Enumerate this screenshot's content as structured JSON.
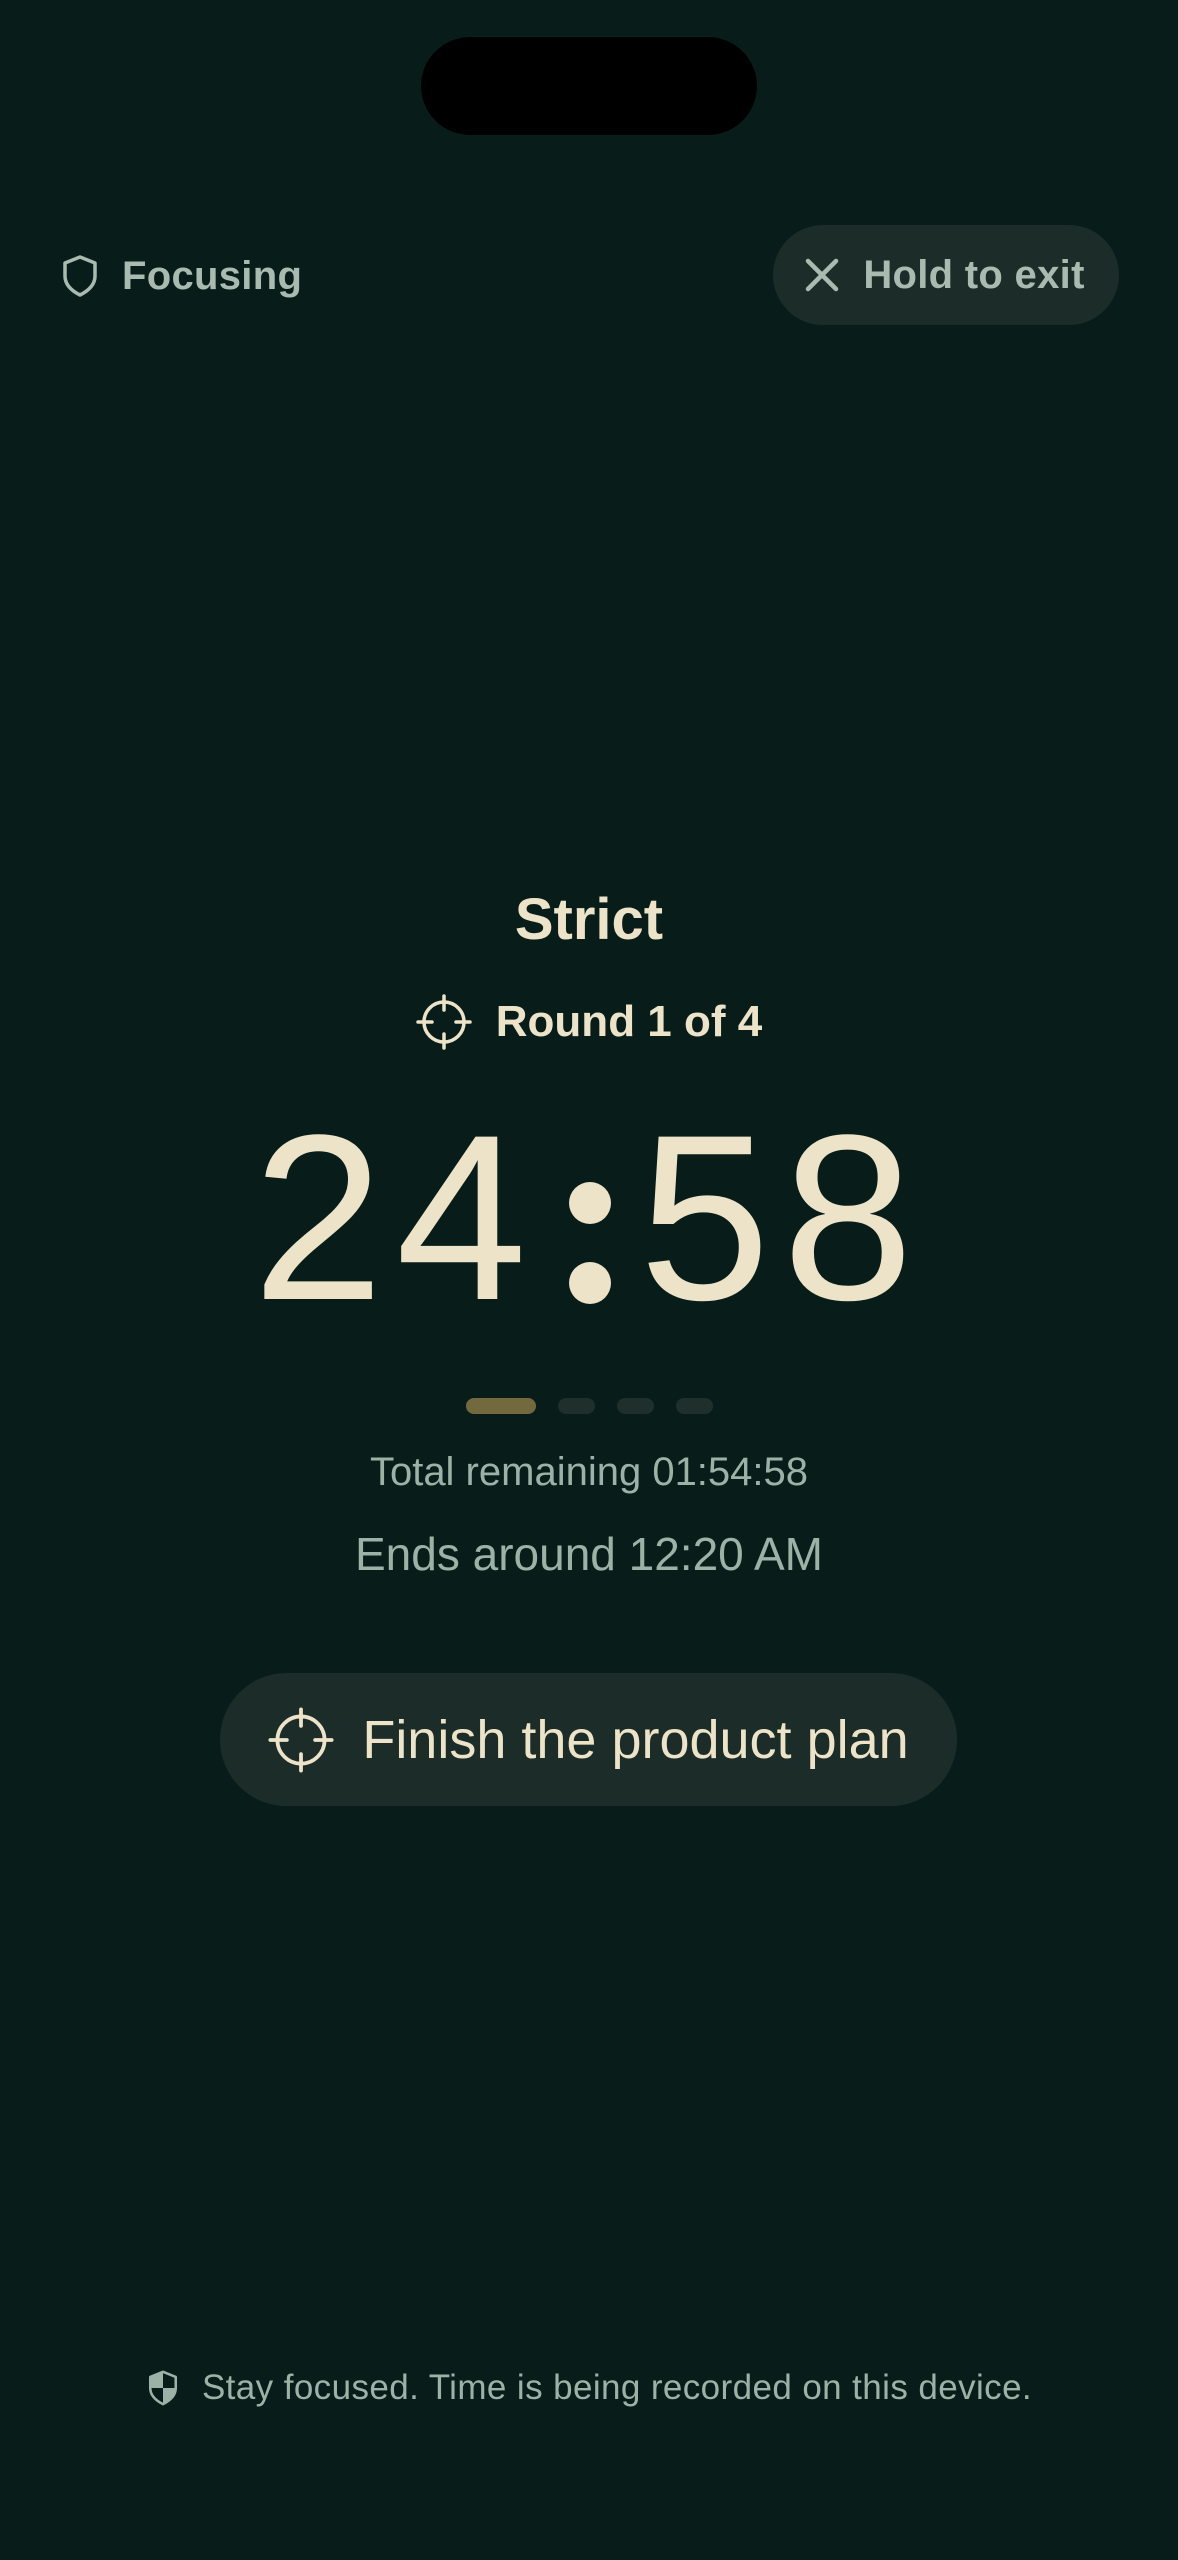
{
  "status": {
    "focus_label": "Focusing",
    "focus_icon": "shield-icon"
  },
  "exit": {
    "label": "Hold to exit",
    "icon": "close-icon"
  },
  "session": {
    "mode": "Strict",
    "round_label": "Round 1 of 4",
    "round_icon": "crosshair-icon",
    "timer_minutes": "24",
    "timer_seconds": "58",
    "rounds_total": 4,
    "rounds_current": 1,
    "total_remaining": "Total remaining 01:54:58",
    "ends_around": "Ends around 12:20 AM"
  },
  "task": {
    "label": "Finish the product plan",
    "icon": "crosshair-icon"
  },
  "footer": {
    "message": "Stay focused. Time is being recorded on this device.",
    "icon": "shield-check-icon"
  },
  "colors": {
    "background": "#081d1a",
    "pill_background": "#1c2d29",
    "primary_text": "#ece3c8",
    "muted_text": "#9db2a7",
    "progress_active": "#73693f",
    "progress_inactive": "#1f302c"
  }
}
